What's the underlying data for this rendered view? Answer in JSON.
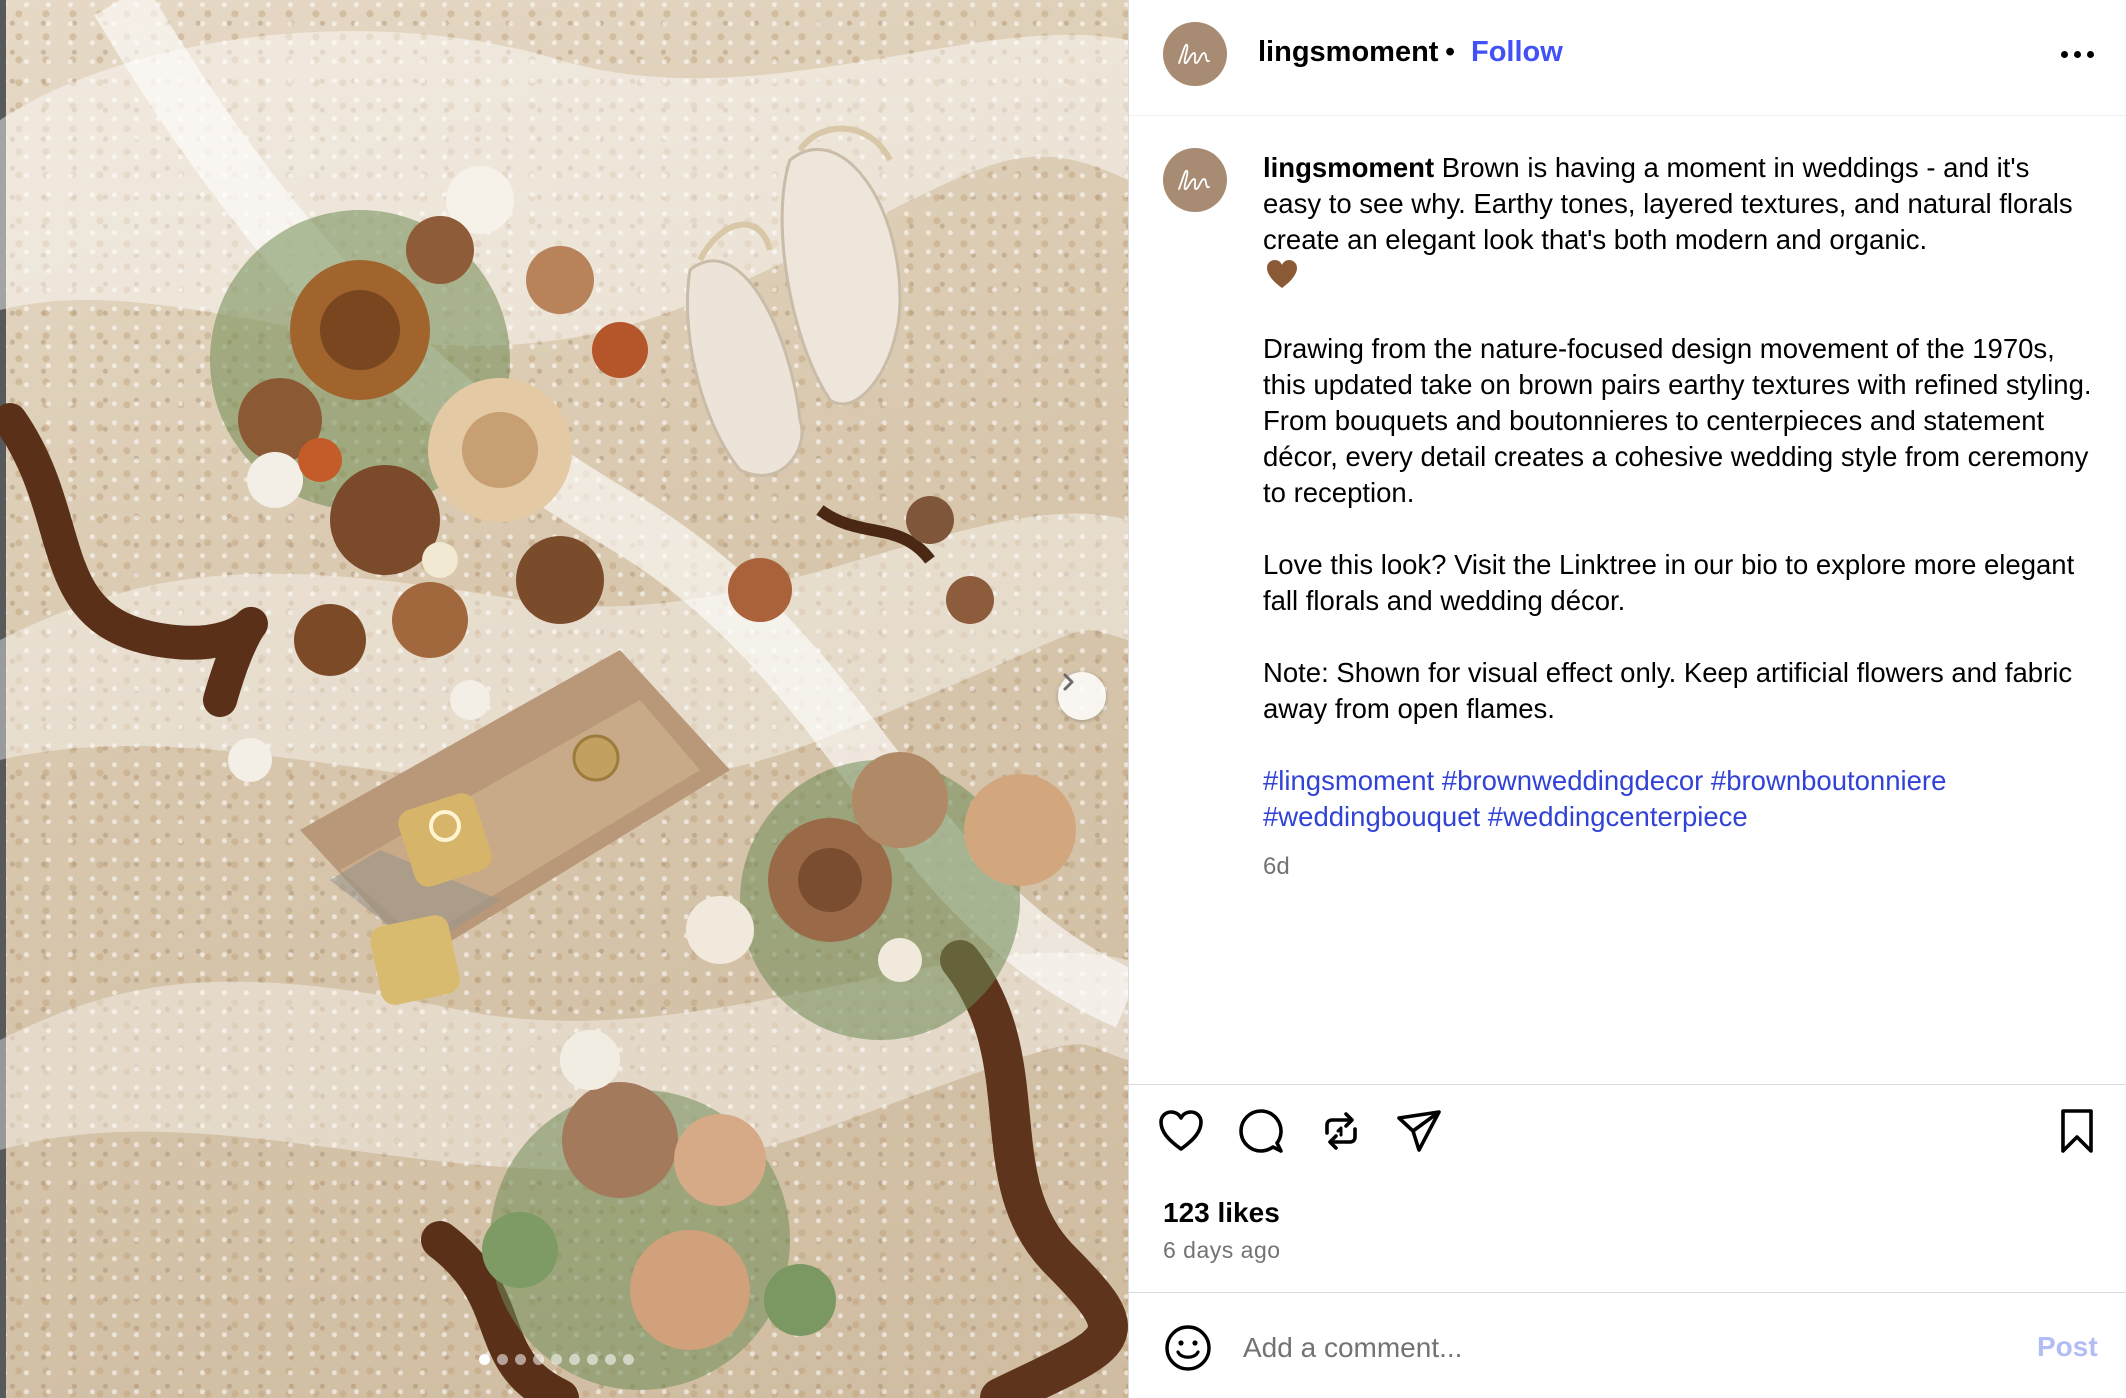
{
  "post": {
    "username": "lingsmoment",
    "separator": "•",
    "follow_label": "Follow",
    "avatar_icon": "lingsmoment-logo-icon",
    "more_icon": "more-options-icon"
  },
  "caption": {
    "username": "lingsmoment",
    "paragraph1": "Brown is having a moment in weddings - and it's easy to see why. Earthy tones, layered textures, and natural florals create an elegant look that's both modern and organic.",
    "emoji": "brown-heart-emoji",
    "paragraph2": "Drawing from the nature-focused design movement of the 1970s, this updated take on brown pairs earthy textures with refined styling. From bouquets and boutonnieres to centerpieces and statement décor, every detail creates a cohesive wedding style from ceremony to reception.",
    "paragraph3": "Love this look? Visit the Linktree in our bio to explore more elegant fall florals and wedding décor.",
    "paragraph4": "Note: Shown for visual effect only. Keep artificial flowers and fabric away from open flames.",
    "hashtags": [
      "#lingsmoment",
      "#brownweddingdecor",
      "#brownboutonniere",
      "#weddingbouquet",
      "#weddingcenterpiece"
    ],
    "age": "6d"
  },
  "media": {
    "slide_count": 9,
    "active_slide": 1,
    "next_icon": "chevron-right-icon"
  },
  "actions": {
    "icons": [
      "heart-icon",
      "comment-icon",
      "repost-icon",
      "share-icon",
      "bookmark-icon"
    ],
    "likes": "123 likes",
    "date": "6 days ago"
  },
  "comment": {
    "placeholder": "Add a comment...",
    "post_label": "Post",
    "emoji_icon": "emoji-icon"
  },
  "colors": {
    "link": "#4150f7",
    "hashtag": "#3143d6",
    "post_disabled": "#b2bcf5",
    "muted": "#737373",
    "avatar": "#a78b72"
  }
}
